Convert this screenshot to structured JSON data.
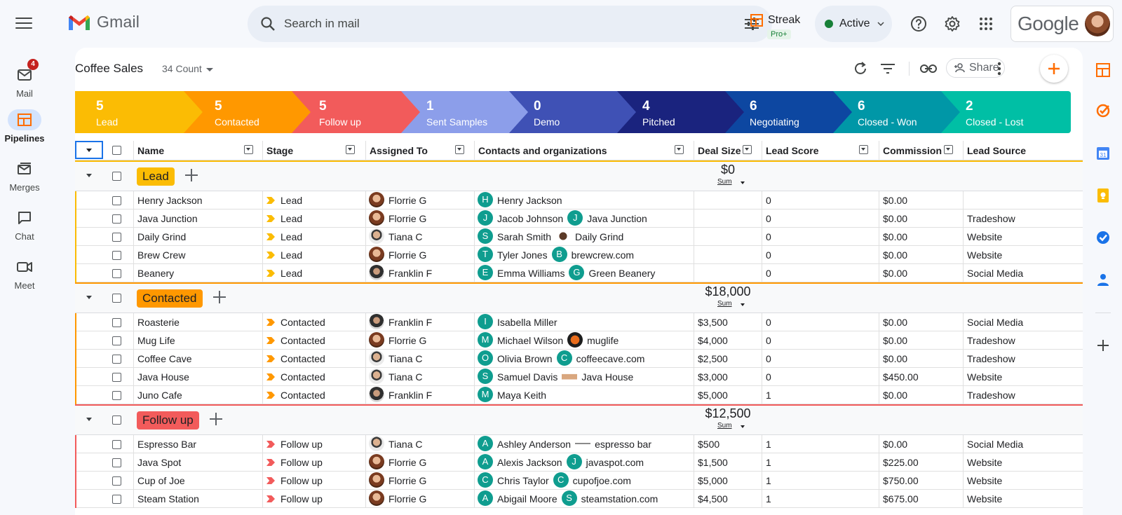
{
  "app": {
    "name": "Gmail"
  },
  "rail": {
    "items": [
      {
        "label": "Mail",
        "badge": "4",
        "icon": "mail-icon"
      },
      {
        "label": "Pipelines",
        "icon": "pipelines-icon"
      },
      {
        "label": "Merges",
        "icon": "merges-icon"
      },
      {
        "label": "Chat",
        "icon": "chat-icon"
      },
      {
        "label": "Meet",
        "icon": "meet-icon"
      }
    ]
  },
  "search": {
    "placeholder": "Search in mail"
  },
  "streak": {
    "name": "Streak",
    "tier": "Pro+"
  },
  "status": {
    "label": "Active"
  },
  "account": {
    "brand": "Google"
  },
  "pipeline": {
    "title": "Coffee Sales",
    "count_label": "34 Count",
    "share_label": "Share"
  },
  "colors": {
    "lead": "#fbbc04",
    "contacted": "#ff9800",
    "follow_up": "#f25b5b",
    "sent_samples": "#8c9eea",
    "demo": "#3f51b5",
    "pitched": "#1a237e",
    "negotiating": "#0d47a1",
    "closed_won": "#0097a7",
    "closed_lost": "#00bfa5",
    "contact_icon": "#0f9d8f",
    "selection": "#1a73e8"
  },
  "stages": [
    {
      "count": "5",
      "name": "Lead"
    },
    {
      "count": "5",
      "name": "Contacted"
    },
    {
      "count": "5",
      "name": "Follow up"
    },
    {
      "count": "1",
      "name": "Sent Samples"
    },
    {
      "count": "0",
      "name": "Demo"
    },
    {
      "count": "4",
      "name": "Pitched"
    },
    {
      "count": "6",
      "name": "Negotiating"
    },
    {
      "count": "6",
      "name": "Closed - Won"
    },
    {
      "count": "2",
      "name": "Closed - Lost"
    }
  ],
  "columns": [
    "Name",
    "Stage",
    "Assigned To",
    "Contacts and organizations",
    "Deal Size",
    "Lead Score",
    "Commission",
    "Lead Source"
  ],
  "groups": [
    {
      "name": "Lead",
      "sum": "$0",
      "sum_label": "Sum",
      "rows": [
        {
          "name": "Henry Jackson",
          "stage": "Lead",
          "assigned": "Florrie G",
          "contact": "Henry Jackson",
          "contact_initial": "H",
          "org": "",
          "org_initial": "",
          "deal": "",
          "score": "0",
          "commission": "$0.00",
          "source": ""
        },
        {
          "name": "Java Junction",
          "stage": "Lead",
          "assigned": "Florrie G",
          "contact": "Jacob Johnson",
          "contact_initial": "J",
          "org": "Java Junction",
          "org_initial": "J",
          "deal": "",
          "score": "0",
          "commission": "$0.00",
          "source": "Tradeshow"
        },
        {
          "name": "Daily Grind",
          "stage": "Lead",
          "assigned": "Tiana C",
          "contact": "Sarah Smith",
          "contact_initial": "S",
          "org": "Daily Grind",
          "org_initial": "",
          "deal": "",
          "score": "0",
          "commission": "$0.00",
          "source": "Website"
        },
        {
          "name": "Brew Crew",
          "stage": "Lead",
          "assigned": "Florrie G",
          "contact": "Tyler Jones",
          "contact_initial": "T",
          "org": "brewcrew.com",
          "org_initial": "B",
          "deal": "",
          "score": "0",
          "commission": "$0.00",
          "source": "Website"
        },
        {
          "name": "Beanery",
          "stage": "Lead",
          "assigned": "Franklin F",
          "contact": "Emma Williams",
          "contact_initial": "E",
          "org": "Green Beanery",
          "org_initial": "G",
          "deal": "",
          "score": "0",
          "commission": "$0.00",
          "source": "Social Media"
        }
      ]
    },
    {
      "name": "Contacted",
      "sum": "$18,000",
      "sum_label": "Sum",
      "rows": [
        {
          "name": "Roasterie",
          "stage": "Contacted",
          "assigned": "Franklin F",
          "contact": "Isabella Miller",
          "contact_initial": "I",
          "org": "",
          "org_initial": "",
          "deal": "$3,500",
          "score": "0",
          "commission": "$0.00",
          "source": "Social Media"
        },
        {
          "name": "Mug Life",
          "stage": "Contacted",
          "assigned": "Florrie G",
          "contact": "Michael Wilson",
          "contact_initial": "M",
          "org": "muglife",
          "org_initial": "",
          "deal": "$4,000",
          "score": "0",
          "commission": "$0.00",
          "source": "Tradeshow"
        },
        {
          "name": "Coffee Cave",
          "stage": "Contacted",
          "assigned": "Tiana C",
          "contact": "Olivia Brown",
          "contact_initial": "O",
          "org": "coffeecave.com",
          "org_initial": "C",
          "deal": "$2,500",
          "score": "0",
          "commission": "$0.00",
          "source": "Tradeshow"
        },
        {
          "name": "Java House",
          "stage": "Contacted",
          "assigned": "Tiana C",
          "contact": "Samuel Davis",
          "contact_initial": "S",
          "org": "Java House",
          "org_initial": "",
          "deal": "$3,000",
          "score": "0",
          "commission": "$450.00",
          "source": "Website"
        },
        {
          "name": "Juno Cafe",
          "stage": "Contacted",
          "assigned": "Franklin F",
          "contact": "Maya Keith",
          "contact_initial": "M",
          "org": "",
          "org_initial": "",
          "deal": "$5,000",
          "score": "1",
          "commission": "$0.00",
          "source": "Tradeshow"
        }
      ]
    },
    {
      "name": "Follow up",
      "sum": "$12,500",
      "sum_label": "Sum",
      "rows": [
        {
          "name": "Espresso Bar",
          "stage": "Follow up",
          "assigned": "Tiana C",
          "contact": "Ashley Anderson",
          "contact_initial": "A",
          "org": "espresso bar",
          "org_initial": "",
          "deal": "$500",
          "score": "1",
          "commission": "$0.00",
          "source": "Social Media"
        },
        {
          "name": "Java Spot",
          "stage": "Follow up",
          "assigned": "Florrie G",
          "contact": "Alexis Jackson",
          "contact_initial": "A",
          "org": "javaspot.com",
          "org_initial": "J",
          "deal": "$1,500",
          "score": "1",
          "commission": "$225.00",
          "source": "Website"
        },
        {
          "name": "Cup of Joe",
          "stage": "Follow up",
          "assigned": "Florrie G",
          "contact": "Chris Taylor",
          "contact_initial": "C",
          "org": "cupofjoe.com",
          "org_initial": "C",
          "deal": "$5,000",
          "score": "1",
          "commission": "$750.00",
          "source": "Website"
        },
        {
          "name": "Steam Station",
          "stage": "Follow up",
          "assigned": "Florrie G",
          "contact": "Abigail Moore",
          "contact_initial": "A",
          "org": "steamstation.com",
          "org_initial": "S",
          "deal": "$4,500",
          "score": "1",
          "commission": "$675.00",
          "source": "Website"
        }
      ]
    }
  ]
}
